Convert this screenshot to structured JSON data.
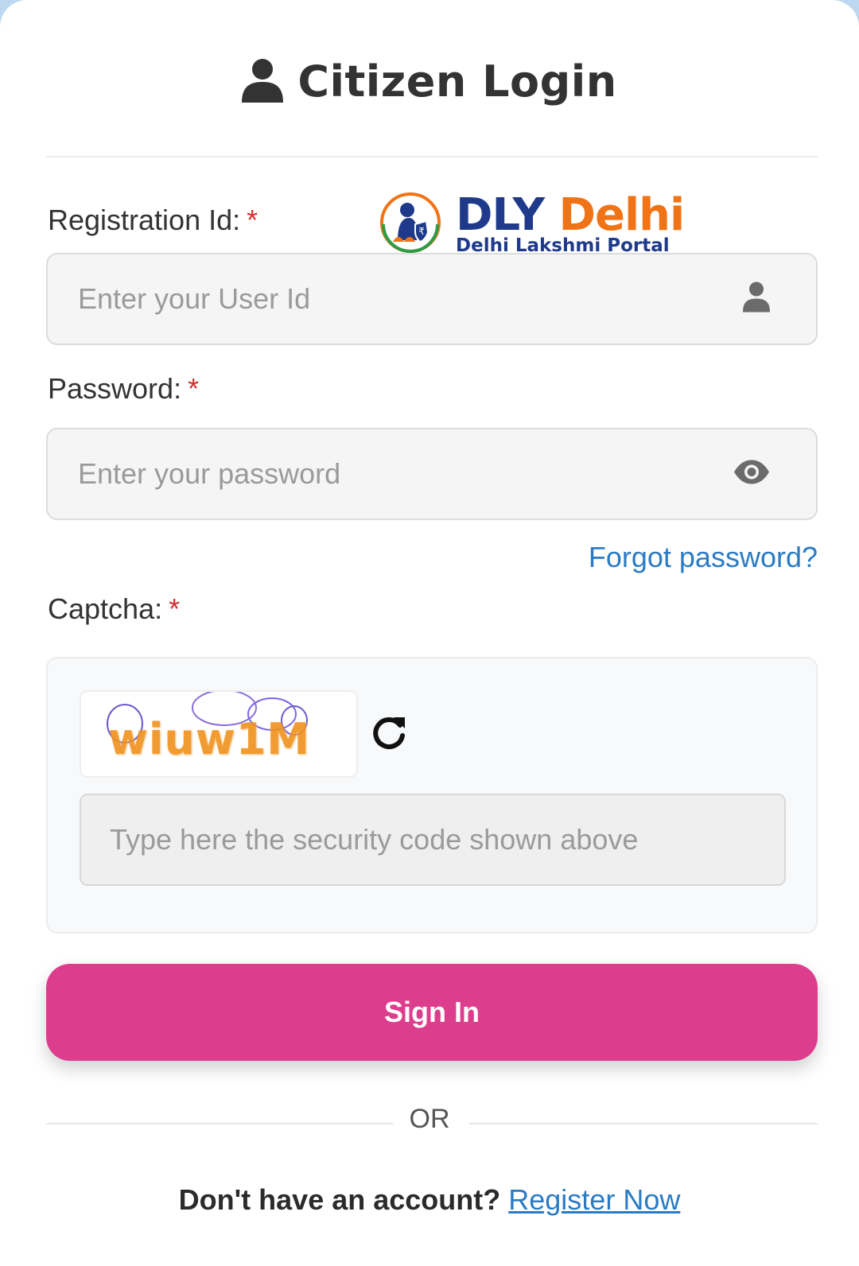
{
  "header": {
    "title": "Citizen Login"
  },
  "brand": {
    "name_part1": "DLY",
    "name_part2": "Delhi",
    "subtitle": "Delhi Lakshmi Portal",
    "colors": {
      "primary": "#1f3a8a",
      "accent": "#f07316"
    }
  },
  "form": {
    "registration": {
      "label": "Registration Id:",
      "required_mark": "*",
      "placeholder": "Enter your User Id",
      "icon": "user-icon"
    },
    "password": {
      "label": "Password:",
      "required_mark": "*",
      "placeholder": "Enter your password",
      "icon": "eye-icon"
    },
    "forgot_label": "Forgot password?",
    "captcha": {
      "label": "Captcha:",
      "required_mark": "*",
      "code": "wiuw1M",
      "placeholder": "Type here the security code shown above",
      "refresh_icon": "refresh-icon"
    },
    "submit_label": "Sign In",
    "submit_color": "#dd3d8d"
  },
  "footer": {
    "or_text": "OR",
    "question": "Don't have an account?",
    "register_label": "Register Now"
  }
}
